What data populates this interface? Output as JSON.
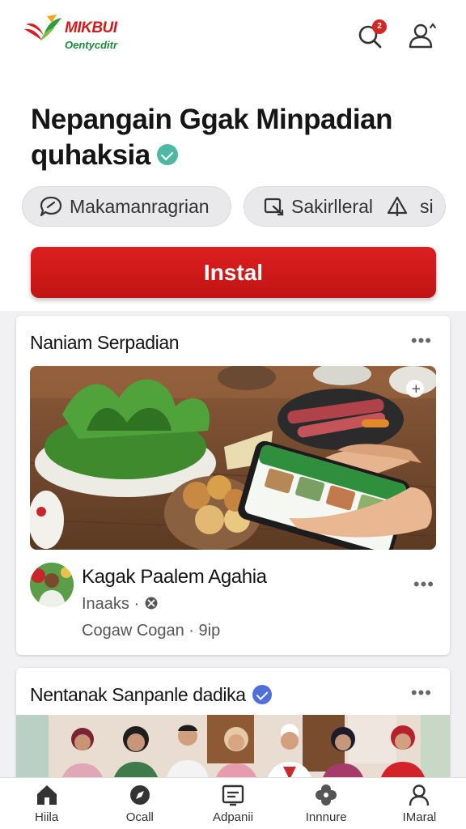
{
  "app": {
    "logo_line1": "MIKBUI",
    "logo_line2": "Oentycditr",
    "notification_count": "2"
  },
  "header": {
    "title": "Nepangain Ggak Minpadian quhaksia"
  },
  "chips": [
    {
      "label": "Makamanragrian",
      "icon": "chat-bubble-icon"
    },
    {
      "label": "Sakirlleral",
      "icon": "share-icon",
      "extra_label": "si",
      "extra_icon": "warning-icon"
    }
  ],
  "install_label": "Instal",
  "card1": {
    "title": "Naniam Serpadian",
    "more_label": "•••",
    "author_name": "Kagak Paalem Agahia",
    "author_sub": "Inaaks ·",
    "meta": "Cogaw Cogan · 9ip",
    "post_more_label": "•••"
  },
  "card2": {
    "title": "Nentanak Sanpanle dadika",
    "more_label": "•••"
  },
  "bottom_nav": [
    {
      "label": "Hiila",
      "icon": "home-icon"
    },
    {
      "label": "Ocall",
      "icon": "compass-icon"
    },
    {
      "label": "Adpanii",
      "icon": "screen-icon"
    },
    {
      "label": "Innnure",
      "icon": "clover-icon"
    },
    {
      "label": "IMaral",
      "icon": "profile-icon"
    }
  ],
  "colors": {
    "brand_red": "#cf1d1d",
    "brand_green": "#1e8a3a",
    "install_red": "#d11a1a",
    "verified_teal": "#4fb8a3",
    "verified_blue": "#4f6fd9"
  }
}
